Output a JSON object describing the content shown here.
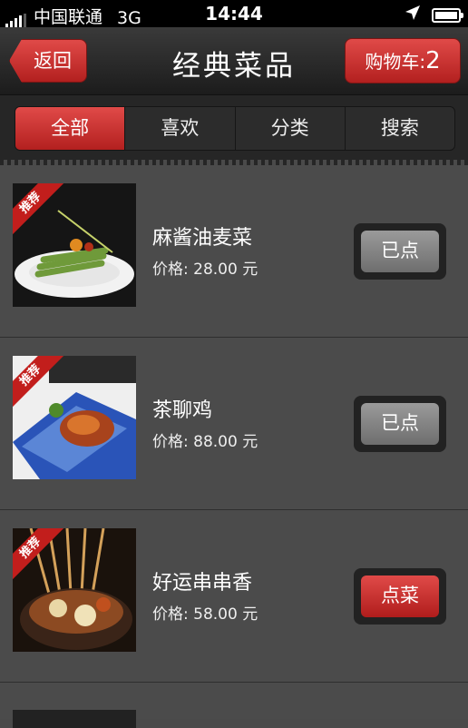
{
  "status_bar": {
    "carrier": "中国联通",
    "network": "3G",
    "time": "14:44"
  },
  "nav": {
    "back_label": "返回",
    "title": "经典菜品",
    "cart_label": "购物车:",
    "cart_count": "2"
  },
  "tabs": [
    {
      "label": "全部",
      "active": true
    },
    {
      "label": "喜欢",
      "active": false
    },
    {
      "label": "分类",
      "active": false
    },
    {
      "label": "搜索",
      "active": false
    }
  ],
  "dishes": [
    {
      "badge": "推荐",
      "name": "麻酱油麦菜",
      "price": "价格: 28.00 元",
      "action": "已点",
      "ordered": true
    },
    {
      "badge": "推荐",
      "name": "茶聊鸡",
      "price": "价格: 88.00 元",
      "action": "已点",
      "ordered": true
    },
    {
      "badge": "推荐",
      "name": "好运串串香",
      "price": "价格: 58.00 元",
      "action": "点菜",
      "ordered": false
    }
  ],
  "colors": {
    "accent_red": "#c8302e",
    "background": "#4a4a4a",
    "nav_dark": "#1c1c1c"
  }
}
